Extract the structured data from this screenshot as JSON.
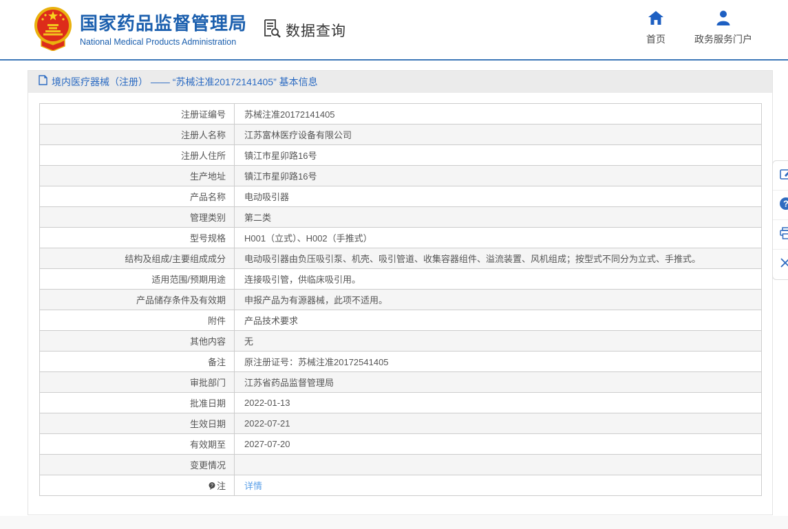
{
  "header": {
    "org_name_cn": "国家药品监督管理局",
    "org_name_en": "National Medical Products Administration",
    "section_title": "数据查询",
    "nav_home_label": "首页",
    "nav_portal_label": "政务服务门户"
  },
  "breadcrumb": {
    "text": "境内医疗器械（注册） —— “苏械注准20172141405” 基本信息"
  },
  "table": {
    "rows": [
      {
        "label": "注册证编号",
        "value": "苏械注准20172141405"
      },
      {
        "label": "注册人名称",
        "value": "江苏富林医疗设备有限公司"
      },
      {
        "label": "注册人住所",
        "value": "镇江市星卯路16号"
      },
      {
        "label": "生产地址",
        "value": "镇江市星卯路16号"
      },
      {
        "label": "产品名称",
        "value": "电动吸引器"
      },
      {
        "label": "管理类别",
        "value": "第二类"
      },
      {
        "label": "型号规格",
        "value": "H001（立式）、H002（手推式）"
      },
      {
        "label": "结构及组成/主要组成成分",
        "value": "电动吸引器由负压吸引泵、机壳、吸引管道、收集容器组件、溢流装置、风机组成；按型式不同分为立式、手推式。"
      },
      {
        "label": "适用范围/预期用途",
        "value": "连接吸引管，供临床吸引用。"
      },
      {
        "label": "产品储存条件及有效期",
        "value": "申报产品为有源器械，此项不适用。"
      },
      {
        "label": "附件",
        "value": "产品技术要求"
      },
      {
        "label": "其他内容",
        "value": "无"
      },
      {
        "label": "备注",
        "value": "原注册证号：苏械注准20172541405"
      },
      {
        "label": "审批部门",
        "value": "江苏省药品监督管理局"
      },
      {
        "label": "批准日期",
        "value": "2022-01-13"
      },
      {
        "label": "生效日期",
        "value": "2022-07-21"
      },
      {
        "label": "有效期至",
        "value": "2027-07-20"
      },
      {
        "label": "变更情况",
        "value": ""
      },
      {
        "label": "注",
        "value": "详情",
        "link": true,
        "label_icon": "note-balloon-icon"
      }
    ]
  },
  "side_toolbar": {
    "items": [
      "edit-icon",
      "help-icon",
      "print-icon",
      "close-icon"
    ]
  },
  "colors": {
    "brand_blue": "#1b5fae",
    "header_rule_blue": "#3d77b8",
    "crumb_text_blue": "#2a6ac2",
    "link_blue": "#5a9fe8",
    "icon_blue": "#1d5fc2",
    "row_alt_bg": "#f5f5f5",
    "table_border": "#cccccc"
  }
}
